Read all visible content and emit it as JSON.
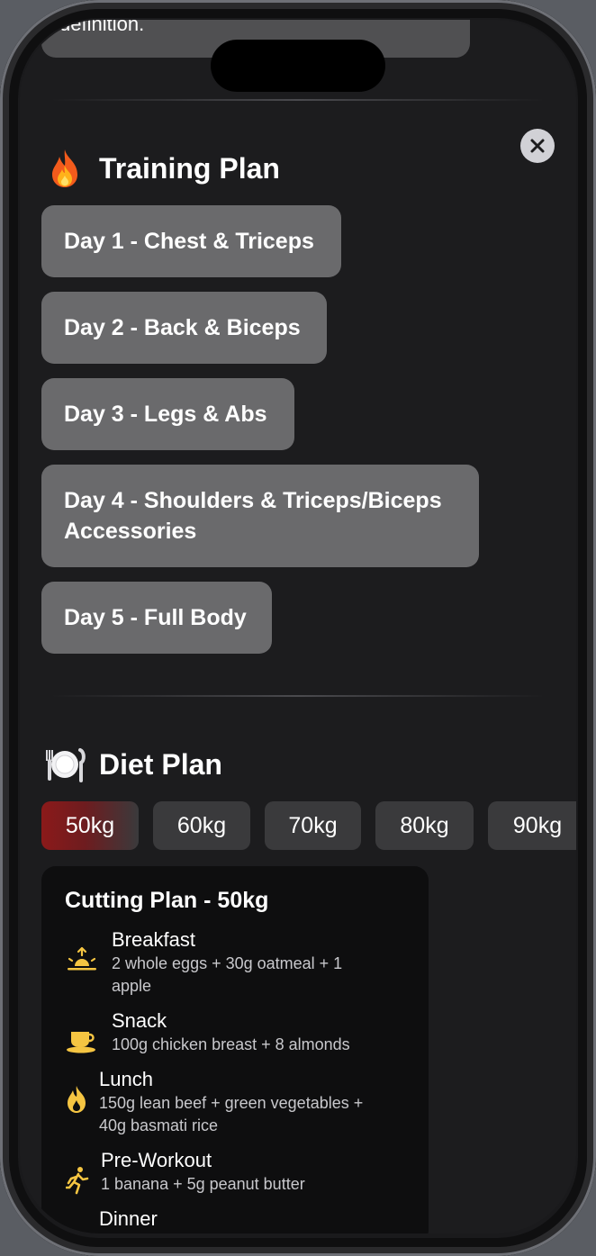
{
  "top_card": {
    "text": "definition."
  },
  "training": {
    "title": "Training Plan",
    "days": [
      {
        "label": "Day 1 - Chest & Triceps"
      },
      {
        "label": "Day 2 - Back & Biceps"
      },
      {
        "label": "Day 3 - Legs & Abs"
      },
      {
        "label": "Day 4 - Shoulders & Triceps/Biceps Accessories"
      },
      {
        "label": "Day 5 - Full Body"
      }
    ]
  },
  "diet": {
    "title": "Diet Plan",
    "weights": [
      "50kg",
      "60kg",
      "70kg",
      "80kg",
      "90kg"
    ],
    "selected_weight": "50kg",
    "plan_title": "Cutting Plan - 50kg",
    "meals": [
      {
        "name": "Breakfast",
        "desc": "2 whole eggs + 30g oatmeal + 1 apple",
        "icon": "sunrise-icon"
      },
      {
        "name": "Snack",
        "desc": "100g chicken breast + 8 almonds",
        "icon": "cup-icon"
      },
      {
        "name": "Lunch",
        "desc": "150g lean beef + green vegetables + 40g basmati rice",
        "icon": "flame-icon"
      },
      {
        "name": "Pre-Workout",
        "desc": "1 banana + 5g peanut butter",
        "icon": "running-icon"
      },
      {
        "name": "Dinner",
        "desc": "",
        "icon": ""
      }
    ]
  },
  "colors": {
    "accent": "#8b1a1a",
    "icon_yellow": "#f5c542"
  }
}
